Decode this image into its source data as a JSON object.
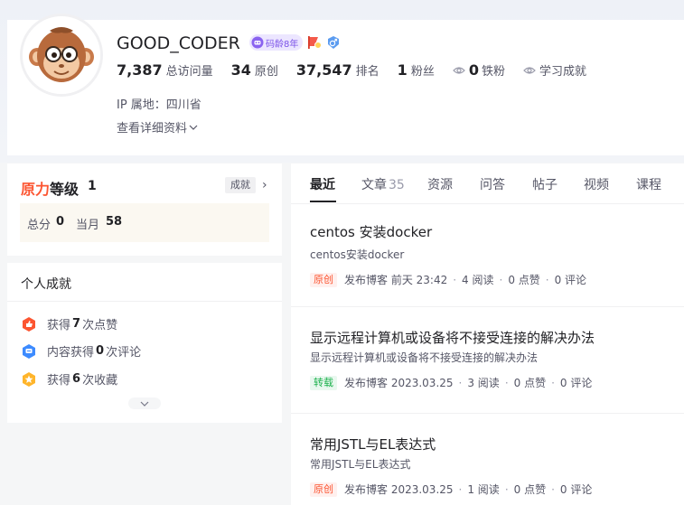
{
  "profile": {
    "username": "GOOD_CODER",
    "code_age_badge": "码龄8年",
    "stats": {
      "visits": {
        "value": "7,387",
        "label": "总访问量"
      },
      "original": {
        "value": "34",
        "label": "原创"
      },
      "rank": {
        "value": "37,547",
        "label": "排名"
      },
      "fans": {
        "value": "1",
        "label": "粉丝"
      },
      "iron_fans": {
        "value": "0",
        "label": "铁粉"
      },
      "achievements_label": "学习成就"
    },
    "ip_location": "IP 属地：四川省",
    "detail_link": "查看详细资料"
  },
  "level": {
    "title_part1": "原力",
    "title_part2": "等级",
    "value": "1",
    "achievement_button": "成就",
    "total_label": "总分",
    "total_value": "0",
    "month_label": "当月",
    "month_value": "58"
  },
  "achievements": {
    "title": "个人成就",
    "items": [
      {
        "prefix": "获得",
        "count": "7",
        "suffix": "次点赞",
        "icon": "thumbs-up-badge-icon",
        "color": "#fc5531"
      },
      {
        "prefix": "内容获得",
        "count": "0",
        "suffix": "次评论",
        "icon": "comment-badge-icon",
        "color": "#3d8bff"
      },
      {
        "prefix": "获得",
        "count": "6",
        "suffix": "次收藏",
        "icon": "star-badge-icon",
        "color": "#ffb52b"
      }
    ]
  },
  "tabs": [
    {
      "label": "最近",
      "count": ""
    },
    {
      "label": "文章",
      "count": "35"
    },
    {
      "label": "资源",
      "count": ""
    },
    {
      "label": "问答",
      "count": ""
    },
    {
      "label": "帖子",
      "count": ""
    },
    {
      "label": "视频",
      "count": ""
    },
    {
      "label": "课程",
      "count": ""
    }
  ],
  "articles": [
    {
      "title": "centos 安装docker",
      "desc": "centos安装docker",
      "tag": "原创",
      "tag_type": "orig",
      "published": "发布博客 前天 23:42",
      "reads": "4 阅读",
      "likes": "0 点赞",
      "comments": "0 评论"
    },
    {
      "title": "显示远程计算机或设备将不接受连接的解决办法",
      "desc": "显示远程计算机或设备将不接受连接的解决办法",
      "tag": "转载",
      "tag_type": "repost",
      "published": "发布博客 2023.03.25",
      "reads": "3 阅读",
      "likes": "0 点赞",
      "comments": "0 评论"
    },
    {
      "title": "常用JSTL与EL表达式",
      "desc": "常用JSTL与EL表达式",
      "tag": "原创",
      "tag_type": "orig",
      "published": "发布博客 2023.03.25",
      "reads": "1 阅读",
      "likes": "0 点赞",
      "comments": "0 评论"
    }
  ],
  "colors": {
    "brand_red": "#fc5531",
    "badge_purple": "#7b52e8",
    "repost_green": "#1ab14b"
  }
}
